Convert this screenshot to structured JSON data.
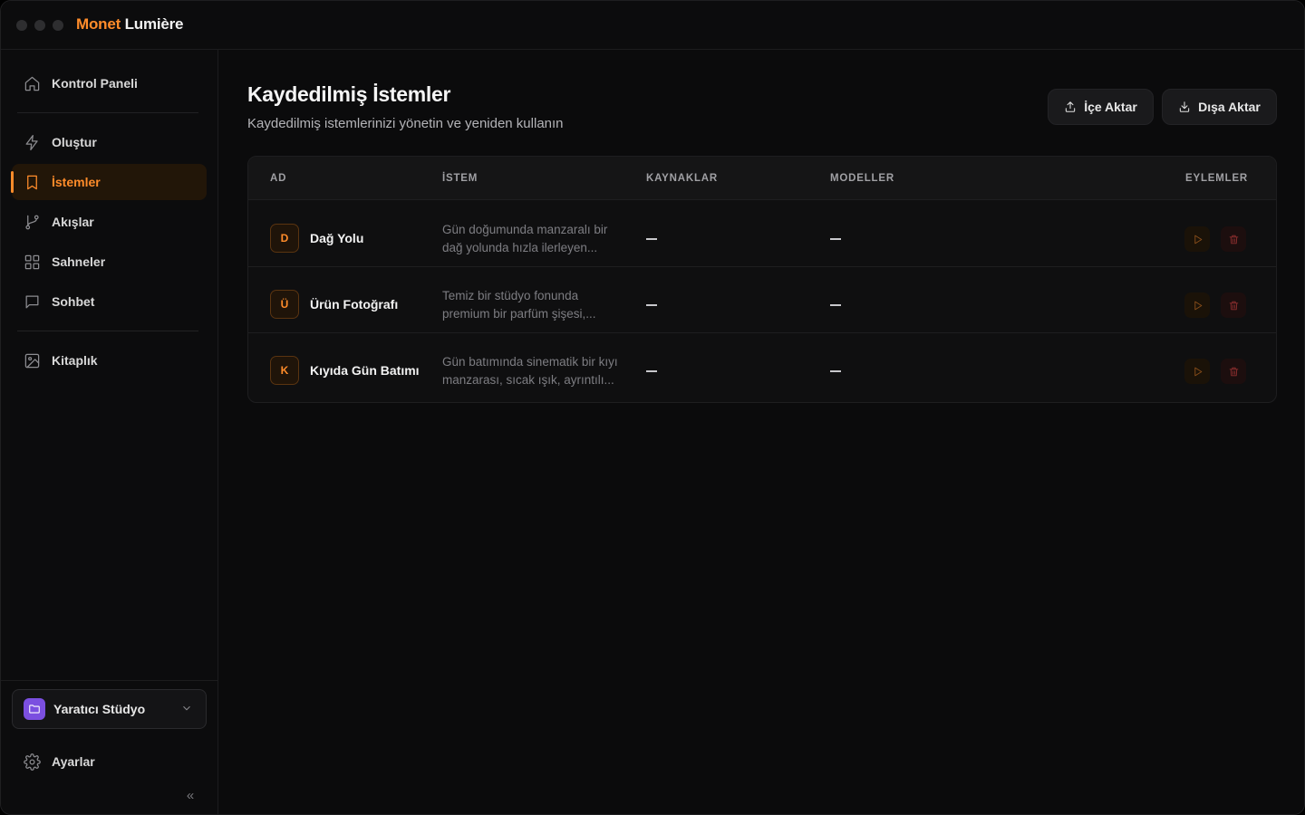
{
  "app": {
    "brand_accent": "Monet",
    "brand_rest": "Lumière"
  },
  "sidebar": {
    "items": [
      {
        "label": "Kontrol Paneli",
        "icon": "home-icon"
      },
      {
        "label": "Oluştur",
        "icon": "bolt-icon"
      },
      {
        "label": "İstemler",
        "icon": "bookmark-icon",
        "active": true
      },
      {
        "label": "Akışlar",
        "icon": "git-branch-icon"
      },
      {
        "label": "Sahneler",
        "icon": "grid-icon"
      },
      {
        "label": "Sohbet",
        "icon": "chat-icon"
      },
      {
        "label": "Kitaplık",
        "icon": "image-icon"
      }
    ],
    "workspace": "Yaratıcı Stüdyo",
    "settings": "Ayarlar",
    "collapse_glyph": "«"
  },
  "main": {
    "title": "Kaydedilmiş İstemler",
    "subtitle": "Kaydedilmiş istemlerinizi yönetin ve yeniden kullanın",
    "import_label": "İçe Aktar",
    "export_label": "Dışa Aktar"
  },
  "table": {
    "headers": {
      "name": "AD",
      "prompt": "İSTEM",
      "sources": "KAYNAKLAR",
      "models": "MODELLER",
      "actions": "EYLEMLER"
    },
    "rows": [
      {
        "initial": "D",
        "name": "Dağ Yolu",
        "prompt": "Gün doğumunda manzaralı bir dağ yolunda hızla ilerleyen...",
        "sources": "—",
        "models": "—"
      },
      {
        "initial": "Ü",
        "name": "Ürün Fotoğrafı",
        "prompt": "Temiz bir stüdyo fonunda premium bir parfüm şişesi,...",
        "sources": "—",
        "models": "—"
      },
      {
        "initial": "K",
        "name": "Kıyıda Gün Batımı",
        "prompt": "Gün batımında sinematik bir kıyı manzarası, sıcak ışık, ayrıntılı...",
        "sources": "—",
        "models": "—"
      }
    ]
  },
  "colors": {
    "accent": "#ff8c2a",
    "background": "#0b0b0c",
    "danger": "#8e2f2f",
    "workspace": "#7b4fe0"
  }
}
